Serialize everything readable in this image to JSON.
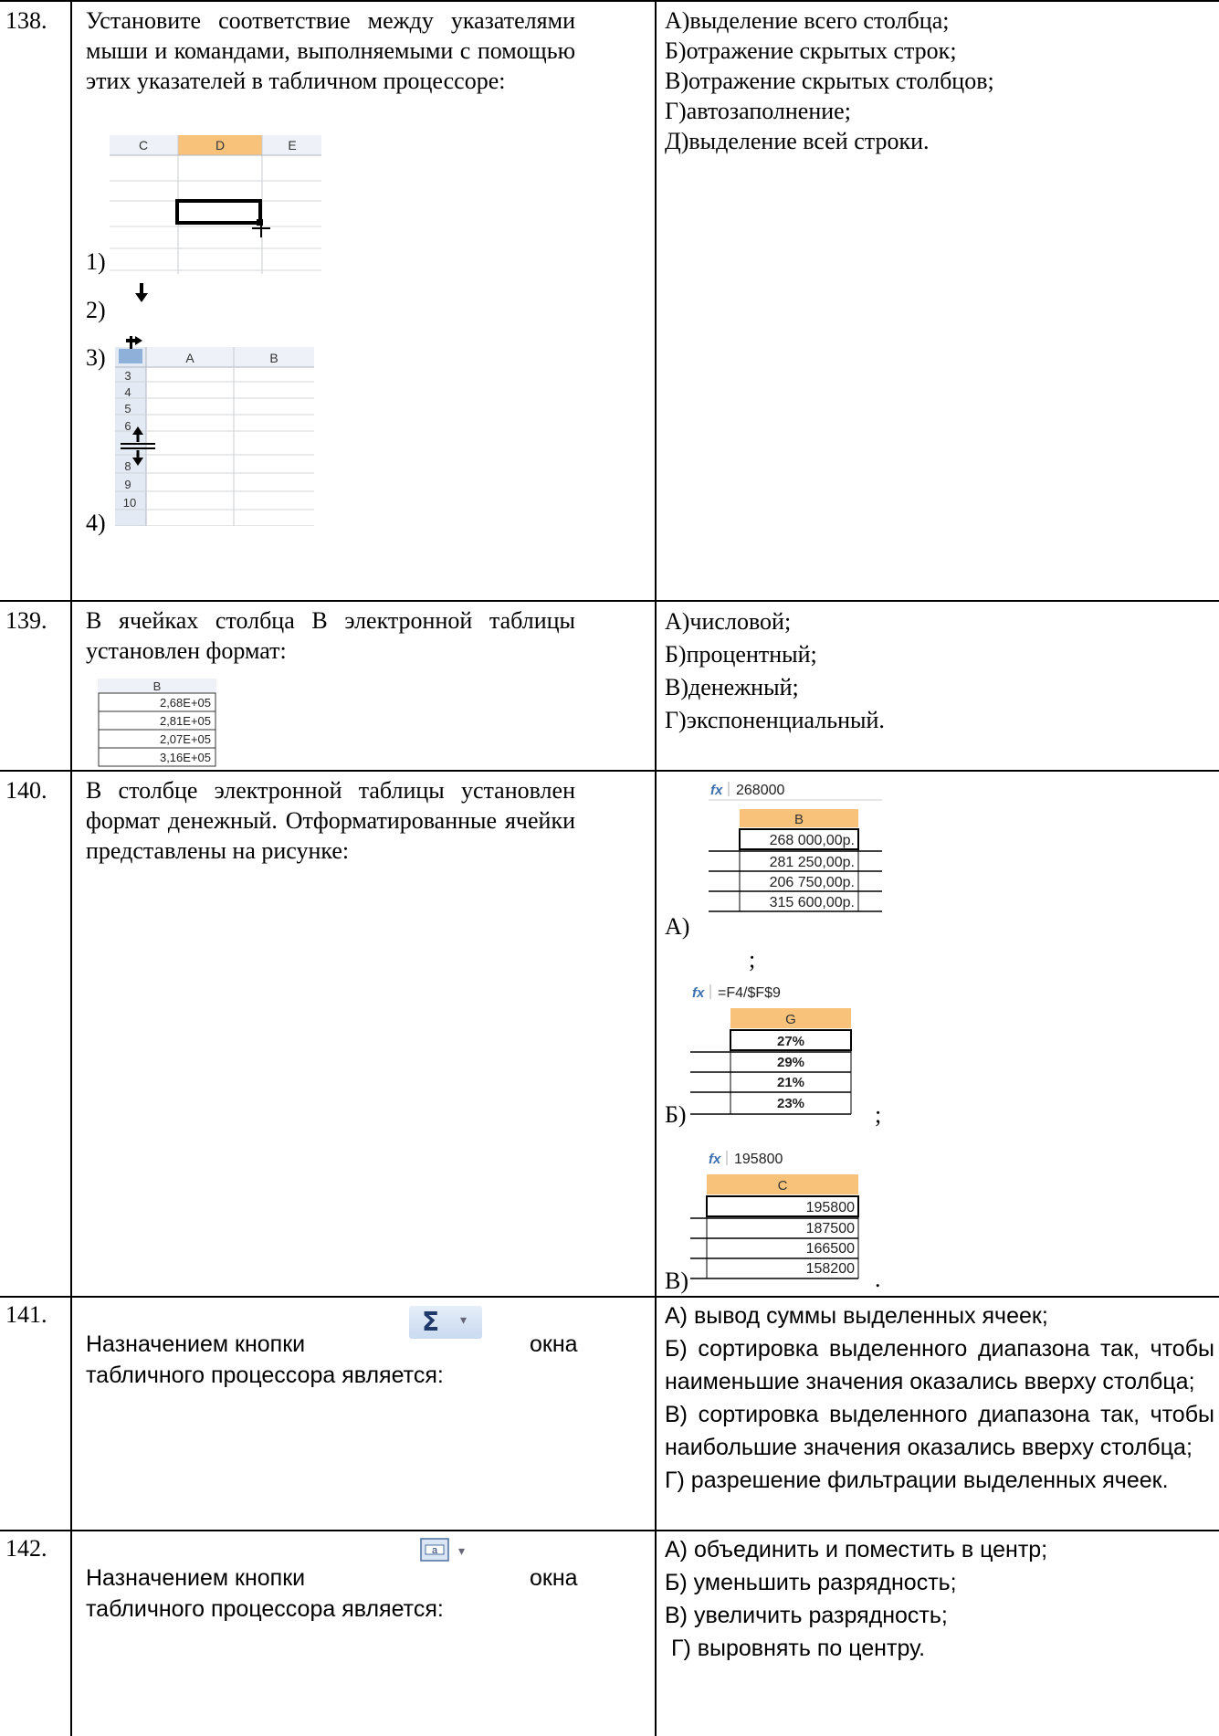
{
  "rows": [
    {
      "number": "138.",
      "question": "Установите соответствие между указателями мыши и командами, выполняемыми с помощью этих указателей в табличном процессоре:",
      "items": [
        "1)",
        "2)",
        "3)",
        "4)"
      ],
      "answers": [
        "А)выделение всего столбца;",
        "Б)отражение скрытых строк;",
        "В)отражение скрытых столбцов;",
        "Г)автозаполнение;",
        "Д)выделение всей строки."
      ],
      "fig1": {
        "columns": [
          "C",
          "D",
          "E"
        ]
      },
      "fig3": {
        "columns": [
          "A",
          "B"
        ],
        "rows": [
          "3",
          "4",
          "5",
          "6",
          "8",
          "9",
          "10"
        ]
      }
    },
    {
      "number": "139.",
      "question": "В ячейках столбца В электронной таблицы установлен формат:",
      "fig": {
        "column": "B",
        "values": [
          "2,68E+05",
          "2,81E+05",
          "2,07E+05",
          "3,16E+05"
        ]
      },
      "answers": [
        "А)числовой;",
        "Б)процентный;",
        "В)денежный;",
        "Г)экспоненциальный."
      ]
    },
    {
      "number": "140.",
      "question": "В столбце электронной таблицы установлен формат денежный. Отформатированные ячейки представлены на рисунке:",
      "options": [
        {
          "label": "А)",
          "formula": "268000",
          "column": "B",
          "values": [
            "268 000,00р.",
            "281 250,00р.",
            "206 750,00р.",
            "315 600,00р."
          ],
          "after": ";"
        },
        {
          "label": "Б)",
          "formula": "=F4/$F$9",
          "column": "G",
          "values": [
            "27%",
            "29%",
            "21%",
            "23%"
          ],
          "after": ";"
        },
        {
          "label": "В)",
          "formula": "195800",
          "column": "C",
          "values": [
            "195800",
            "187500",
            "166500",
            "158200"
          ],
          "after": "."
        }
      ],
      "fx": "fx"
    },
    {
      "number": "141.",
      "question_start": "Назначением кнопки",
      "question_end": "окна",
      "question_line2": "табличного процессора является:",
      "button_glyph": "Σ",
      "answers": [
        "А) вывод суммы выделенных ячеек;",
        "Б) сортировка выделенного диапазона так, чтобы наименьшие значения оказались вверху столбца;",
        "В) сортировка выделенного диапазона так, чтобы наибольшие значения оказались вверху столбца;",
        "Г) разрешение фильтрации выделенных ячеек."
      ]
    },
    {
      "number": "142.",
      "question_start": "Назначением кнопки",
      "question_end": "окна",
      "question_line2": "табличного процессора является:",
      "button_glyph": "a",
      "answers": [
        "А) объединить и поместить в центр;",
        "Б) уменьшить разрядность;",
        "В) увеличить разрядность;",
        " Г) выровнять по центру."
      ]
    }
  ]
}
